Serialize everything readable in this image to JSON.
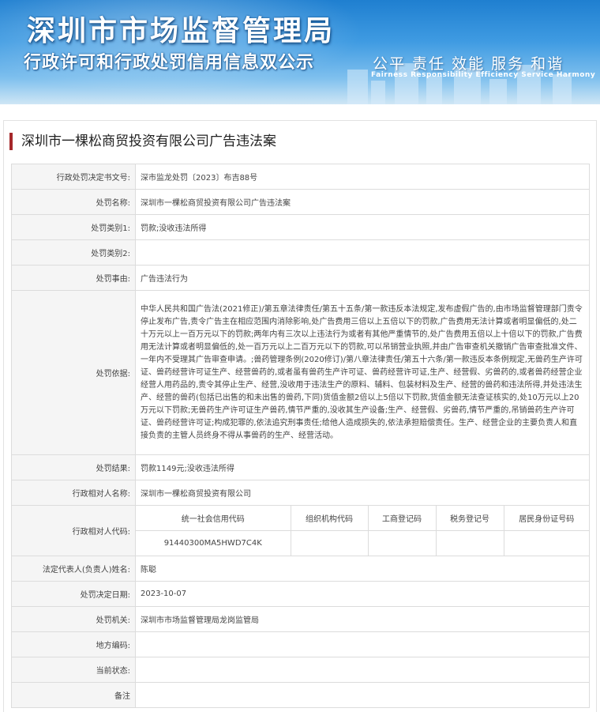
{
  "banner": {
    "title": "深圳市市场监督管理局",
    "subtitle": "行政许可和行政处罚信用信息双公示",
    "slogan": "公平  责任  效能  服务  和谐",
    "slogan_en": "Fairness  Responsibility  Efficiency  Service  Harmony"
  },
  "case_title": "深圳市一棵松商贸投资有限公司广告违法案",
  "fields": {
    "doc_no": {
      "label": "行政处罚决定书文号:",
      "value": "深市监龙处罚〔2023〕布吉88号"
    },
    "case_name": {
      "label": "处罚名称:",
      "value": "深圳市一棵松商贸投资有限公司广告违法案"
    },
    "category1": {
      "label": "处罚类别1:",
      "value": "罚款;没收违法所得"
    },
    "category2": {
      "label": "处罚类别2:",
      "value": ""
    },
    "reason": {
      "label": "处罚事由:",
      "value": "广告违法行为"
    },
    "basis": {
      "label": "处罚依据:",
      "value": "中华人民共和国广告法(2021修正)/第五章法律责任/第五十五条/第一款违反本法规定,发布虚假广告的,由市场监督管理部门责令停止发布广告,责令广告主在相应范围内消除影响,处广告费用三倍以上五倍以下的罚款,广告费用无法计算或者明显偏低的,处二十万元以上一百万元以下的罚款;两年内有三次以上违法行为或者有其他严重情节的,处广告费用五倍以上十倍以下的罚款,广告费用无法计算或者明显偏低的,处一百万元以上二百万元以下的罚款,可以吊销营业执照,并由广告审查机关撤销广告审查批准文件、一年内不受理其广告审查申请。;兽药管理条例(2020修订)/第八章法律责任/第五十六条/第一款违反本条例规定,无兽药生产许可证、兽药经营许可证生产、经营兽药的,或者虽有兽药生产许可证、兽药经营许可证,生产、经营假、劣兽药的,或者兽药经营企业经营人用药品的,责令其停止生产、经营,没收用于违法生产的原料、辅料、包装材料及生产、经营的兽药和违法所得,并处违法生产、经营的兽药(包括已出售的和未出售的兽药,下同)货值金额2倍以上5倍以下罚款,货值金额无法查证核实的,处10万元以上20万元以下罚款;无兽药生产许可证生产兽药,情节严重的,没收其生产设备;生产、经营假、劣兽药,情节严重的,吊销兽药生产许可证、兽药经营许可证;构成犯罪的,依法追究刑事责任;给他人造成损失的,依法承担赔偿责任。生产、经营企业的主要负责人和直接负责的主管人员终身不得从事兽药的生产、经营活动。"
    },
    "result": {
      "label": "处罚结果:",
      "value": "罚款1149元;没收违法所得"
    },
    "party_name": {
      "label": "行政相对人名称:",
      "value": "深圳市一棵松商贸投资有限公司"
    },
    "party_code": {
      "label": "行政相对人代码:",
      "headers": [
        "统一社会信用代码",
        "组织机构代码",
        "工商登记码",
        "税务登记号",
        "居民身份证号码"
      ],
      "values": [
        "91440300MA5HWD7C4K",
        "",
        "",
        "",
        ""
      ]
    },
    "legal_rep": {
      "label": "法定代表人(负责人)姓名:",
      "value": "陈聪"
    },
    "date": {
      "label": "处罚决定日期:",
      "value": "2023-10-07"
    },
    "authority": {
      "label": "处罚机关:",
      "value": "深圳市市场监督管理局龙岗监管局"
    },
    "area_code": {
      "label": "地方编码:",
      "value": ""
    },
    "status": {
      "label": "当前状态:",
      "value": ""
    },
    "remark": {
      "label": "备注",
      "value": ""
    }
  }
}
